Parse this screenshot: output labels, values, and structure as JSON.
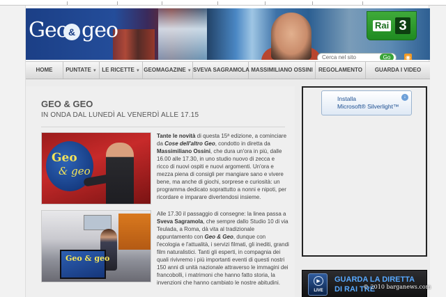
{
  "brand": {
    "logo_left": "Geo",
    "logo_amp": "&",
    "logo_right": "geo",
    "channel_word": "Rai",
    "channel_num": "3"
  },
  "search": {
    "placeholder": "Cerca nel sito",
    "button_label": "Go"
  },
  "nav": {
    "items": [
      {
        "label": "HOME",
        "dropdown": false
      },
      {
        "label": "PUNTATE",
        "dropdown": true
      },
      {
        "label": "LE RICETTE",
        "dropdown": true
      },
      {
        "label": "GEOMAGAZINE",
        "dropdown": true
      },
      {
        "label": "SVEVA SAGRAMOLA",
        "dropdown": false
      },
      {
        "label": "MASSIMILIANO OSSINI",
        "dropdown": false
      },
      {
        "label": "REGOLAMENTO",
        "dropdown": false
      },
      {
        "label": "GUARDA I VIDEO",
        "dropdown": false
      }
    ]
  },
  "main": {
    "title": "GEO & GEO",
    "subtitle": "IN ONDA DAL LUNEDÌ AL VENERDÌ ALLE 17.15",
    "photo1": {
      "disc_text": "Geo",
      "disc_text2": "& geo"
    },
    "photo2": {
      "screen_text": "Geo & geo"
    },
    "para1": {
      "b1": "Tante le novità",
      "t1": " di questa 15ª edizione, a cominciare da ",
      "i1": "Cose dell'altro Geo",
      "t2": ", condotto in diretta da ",
      "b2": "Massimiliano Ossini",
      "t3": ", che dura un'ora in più, dalle 16.00 alle 17.30, in uno studio nuovo di zecca e ricco di nuovi ospiti e nuovi argomenti. Un'ora e mezza piena di consigli per mangiare sano e vivere bene, ma anche di giochi, sorprese e curiosità: un programma dedicato soprattutto a nonni e nipoti, per ricordare e imparare divertendosi insieme."
    },
    "para2": {
      "t1": "Alle 17.30 il passaggio di consegne: la linea passa a ",
      "b1": "Sveva Sagramola",
      "t2": ", che sempre dallo Studio 10 di via Teulada, a Roma, dà vita al tradizionale appuntamento con ",
      "b2": "Geo & Geo",
      "t3": ", dunque con l'ecologia e l'attualità, i servizi filmati, gli inediti, grandi film naturalistici. Tanti gli esperti, in compagnia dei quali rivivremo i più importanti eventi di questi nostri 150 anni di unità nazionale attraverso le immagini dei francobolli, i matrimoni che hanno fatto storia, la invenzioni che hanno cambiato le nostre abitudini."
    }
  },
  "sidebar": {
    "silverlight": {
      "line1": "Installa",
      "line2": "Microsoft® Silverlight™",
      "arrow": "↓"
    },
    "live": {
      "icon_label": "LIVE",
      "line1": "GUARDA LA DIRETTA",
      "line2": "DI RAI TRE"
    }
  },
  "watermark": "© 2010 barganews.com",
  "colors": {
    "rai_green": "#2a9a2c",
    "live_blue": "#58a9ff",
    "banner_blue": "#1b3f86"
  }
}
